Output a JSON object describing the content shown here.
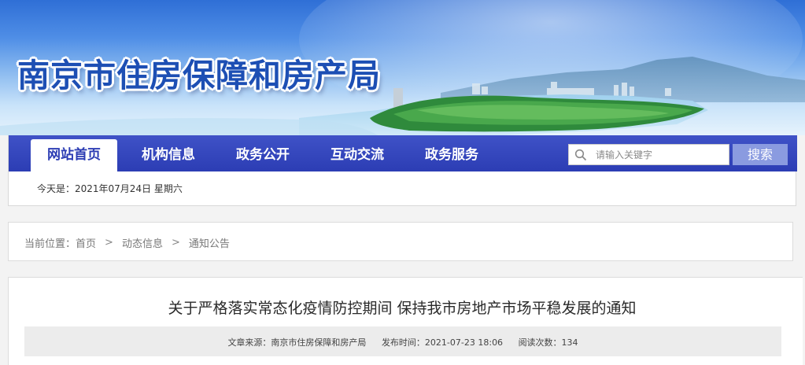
{
  "site": {
    "title": "南京市住房保障和房产局"
  },
  "nav": {
    "items": [
      {
        "label": "网站首页",
        "active": true
      },
      {
        "label": "机构信息",
        "active": false
      },
      {
        "label": "政务公开",
        "active": false
      },
      {
        "label": "互动交流",
        "active": false
      },
      {
        "label": "政务服务",
        "active": false
      }
    ],
    "search_placeholder": "请输入关键字",
    "search_button": "搜索",
    "search_icon": "search-icon"
  },
  "date_line": "今天是：2021年07月24日 星期六",
  "breadcrumb": {
    "prefix": "当前位置：",
    "items": [
      "首页",
      "动态信息",
      "通知公告"
    ],
    "separator": ">"
  },
  "article": {
    "title": "关于严格落实常态化疫情防控期间 保持我市房地产市场平稳发展的通知",
    "source": "文章来源：南京市住房保障和房产局",
    "published": "发布时间：2021-07-23 18:06",
    "views": "阅读次数：134"
  },
  "colors": {
    "nav_bg": "#2c3db4",
    "title_blue": "#1d4fb4",
    "search_button_bg": "#8a9be0"
  }
}
